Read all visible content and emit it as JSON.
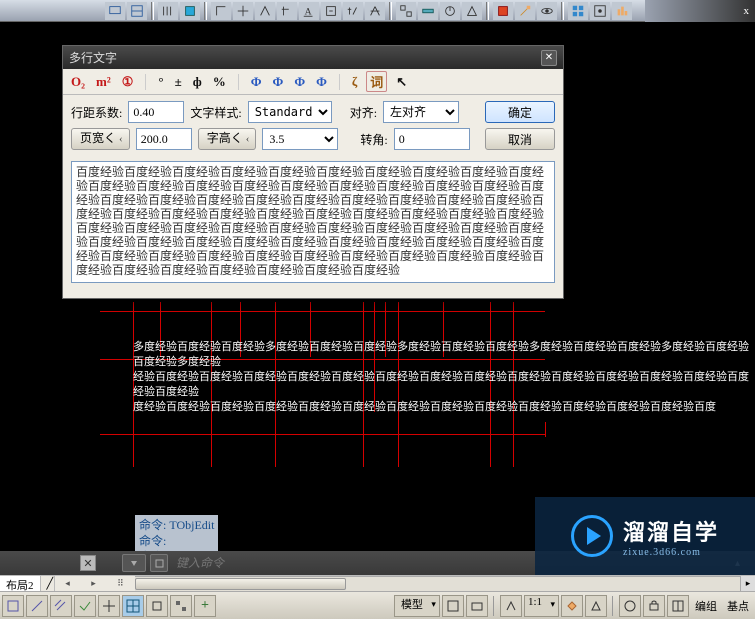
{
  "toolbar": {
    "groups": [
      [
        "tool-01",
        "tool-02"
      ],
      [
        "tool-03",
        "tool-04"
      ],
      [
        "tool-05",
        "tool-06",
        "tool-07",
        "tool-08",
        "tool-09",
        "tool-10",
        "tool-11",
        "tool-12"
      ],
      [
        "tool-13",
        "tool-14",
        "tool-15",
        "tool-16"
      ],
      [
        "tool-17",
        "tool-18",
        "tool-19"
      ],
      [
        "tool-20",
        "tool-21",
        "tool-22"
      ]
    ],
    "tail_marker": "x"
  },
  "dialog": {
    "title": "多行文字",
    "symbols": {
      "o2": "O₂",
      "m2": "m²",
      "circled1": "①",
      "degree": "°",
      "pm": "±",
      "phi_sm": "ф",
      "percent": "%",
      "phi1": "Φ",
      "phi2": "Φ",
      "phi3": "Φ",
      "phi4": "Φ",
      "zeta": "ζ",
      "word": "词",
      "tool": "↖"
    },
    "labels": {
      "line_spacing": "行距系数:",
      "text_style": "文字样式:",
      "alignment": "对齐:",
      "page_width": "页宽く",
      "char_height": "字高く",
      "rotation": "转角:"
    },
    "values": {
      "line_spacing": "0.40",
      "text_style": "Standard",
      "alignment": "左对齐",
      "page_width": "200.0",
      "char_height": "3.5",
      "rotation": "0"
    },
    "buttons": {
      "ok": "确定",
      "cancel": "取消"
    },
    "textarea_text": "百度经验百度经验百度经验百度经验百度经验百度经验百度经验百度经验百度经验百度经验百度经验百度经验百度经验百度经验百度经验百度经验百度经验百度经验百度经验百度经验百度经验百度经验百度经验百度经验百度经验百度经验百度经验百度经验百度经验百度经验百度经验百度经验百度经验百度经验百度经验百度经验百度经验百度经验百度经验百度经验百度经验百度经验百度经验百度经验百度经验百度经验百度经验百度经验百度经验百度经验百度经验百度经验百度经验百度经验百度经验百度经验百度经验百度经验百度经验百度经验百度经验百度经验百度经验百度经验百度经验百度经验百度经验百度经验百度经验百度经验百度经验百度经验百度经验百度经验百度经验"
  },
  "canvas": {
    "text_block": "多度经验百度经验百度经验多度经验百度经验百度经验多度经验百度经验百度经验多度经验百度经验百度经验多度经验百度经验百度经验多度经验\n经验百度经验百度经验百度经验百度经验百度经验百度经验百度经验百度经验百度经验百度经验百度经验百度经验百度经验百度经验百度经验\n度经验百度经验百度经验百度经验百度经验百度经验百度经验百度经验百度经验百度经验百度经验百度经验百度经验百度"
  },
  "command": {
    "history": [
      "命令: TObjEdit",
      "命令:",
      "命令: TObjEdit"
    ],
    "placeholder": "键入命令"
  },
  "tabs": {
    "layout2": "布局2"
  },
  "status": {
    "model": "模型",
    "scale": "1:1",
    "edit_group": "编组",
    "base_point": "基点"
  },
  "watermark": {
    "main": "溜溜自学",
    "sub": "zixue.3d66.com"
  }
}
